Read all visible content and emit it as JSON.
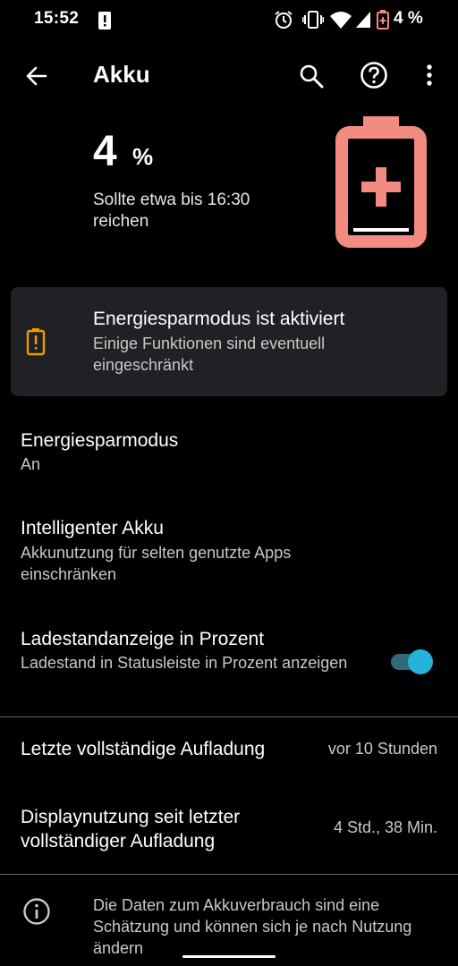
{
  "status_bar": {
    "time": "15:52",
    "battery_percent": "4 %",
    "icons": [
      "alert-icon",
      "alarm-icon",
      "vibrate-icon",
      "wifi-icon",
      "signal-icon",
      "battery-saver-icon"
    ]
  },
  "app_bar": {
    "title": "Akku",
    "icons": [
      "back-arrow-icon",
      "search-icon",
      "help-icon",
      "more-vert-icon"
    ]
  },
  "battery": {
    "level": "4",
    "percent_sign": "%",
    "estimate": "Sollte etwa bis 16:30 reichen",
    "level_fraction": 0.04,
    "battery_color": "#f28b82"
  },
  "saver_card": {
    "title": "Energiesparmodus ist aktiviert",
    "subtitle": "Einige Funktionen sind eventuell eingeschränkt",
    "icon": "battery-alert-icon",
    "icon_color": "#f29900"
  },
  "settings": {
    "battery_saver": {
      "title": "Energiesparmodus",
      "value": "An"
    },
    "smart_battery": {
      "title": "Intelligenter Akku",
      "subtitle": "Akkunutzung für selten genutzte Apps einschränken"
    },
    "percentage": {
      "title": "Ladestandanzeige in Prozent",
      "subtitle": "Ladestand in Statusleiste in Prozent anzeigen",
      "enabled": true
    },
    "last_charge": {
      "title": "Letzte vollständige Aufladung",
      "value": "vor 10 Stunden"
    },
    "screen_usage": {
      "title": "Displaynutzung seit letzter vollständiger Aufladung",
      "value": "4 Std., 38 Min."
    }
  },
  "footer": {
    "text": "Die Daten zum Akkuverbrauch sind eine Schätzung und können sich je nach Nutzung ändern",
    "icon": "info-icon"
  },
  "colors": {
    "accent": "#26b3d9",
    "card_bg": "#202124"
  }
}
